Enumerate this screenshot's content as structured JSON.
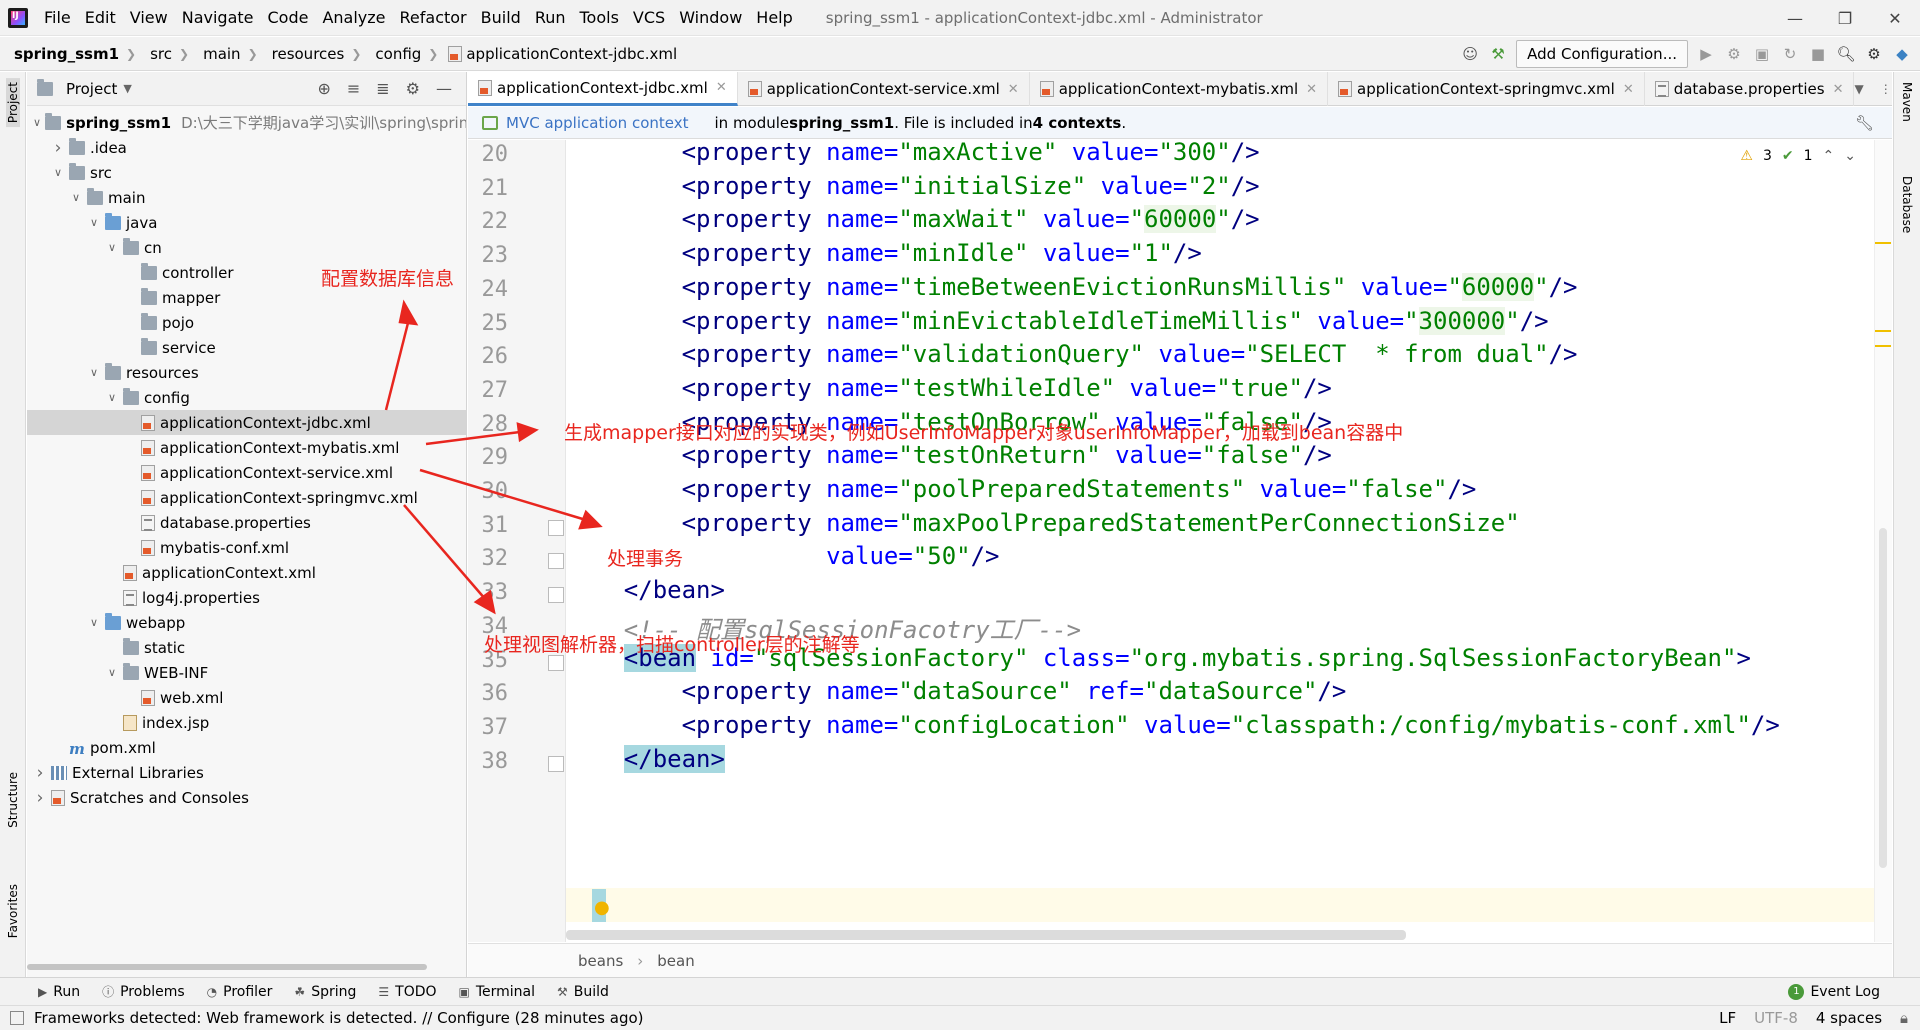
{
  "menubar": {
    "items": [
      "File",
      "Edit",
      "View",
      "Navigate",
      "Code",
      "Analyze",
      "Refactor",
      "Build",
      "Run",
      "Tools",
      "VCS",
      "Window",
      "Help"
    ],
    "title": "spring_ssm1 - applicationContext-jdbc.xml - Administrator"
  },
  "navbar": {
    "crumbs": [
      "spring_ssm1",
      "src",
      "main",
      "resources",
      "config",
      "applicationContext-jdbc.xml"
    ],
    "add_config": "Add Configuration..."
  },
  "left_strip": {
    "project": "Project",
    "structure": "Structure",
    "favorites": "Favorites"
  },
  "right_strip": {
    "maven": "Maven",
    "database": "Database"
  },
  "project_panel": {
    "title": "Project",
    "root_path": "D:\\大三下学期java学习\\实训\\spring\\spring",
    "tree": [
      {
        "label": "spring_ssm1",
        "depth": 0,
        "arrow": "down",
        "icon": "folder"
      },
      {
        "label": ".idea",
        "depth": 1,
        "arrow": "right",
        "icon": "folder"
      },
      {
        "label": "src",
        "depth": 1,
        "arrow": "down",
        "icon": "folder"
      },
      {
        "label": "main",
        "depth": 2,
        "arrow": "down",
        "icon": "folder"
      },
      {
        "label": "java",
        "depth": 3,
        "arrow": "down",
        "icon": "folder-blue"
      },
      {
        "label": "cn",
        "depth": 4,
        "arrow": "down",
        "icon": "folder"
      },
      {
        "label": "controller",
        "depth": 5,
        "arrow": "",
        "icon": "folder"
      },
      {
        "label": "mapper",
        "depth": 5,
        "arrow": "",
        "icon": "folder"
      },
      {
        "label": "pojo",
        "depth": 5,
        "arrow": "",
        "icon": "folder"
      },
      {
        "label": "service",
        "depth": 5,
        "arrow": "",
        "icon": "folder"
      },
      {
        "label": "resources",
        "depth": 3,
        "arrow": "down",
        "icon": "folder"
      },
      {
        "label": "config",
        "depth": 4,
        "arrow": "down",
        "icon": "folder"
      },
      {
        "label": "applicationContext-jdbc.xml",
        "depth": 5,
        "arrow": "",
        "icon": "xml",
        "selected": true
      },
      {
        "label": "applicationContext-mybatis.xml",
        "depth": 5,
        "arrow": "",
        "icon": "xml"
      },
      {
        "label": "applicationContext-service.xml",
        "depth": 5,
        "arrow": "",
        "icon": "xml"
      },
      {
        "label": "applicationContext-springmvc.xml",
        "depth": 5,
        "arrow": "",
        "icon": "xml"
      },
      {
        "label": "database.properties",
        "depth": 5,
        "arrow": "",
        "icon": "prop"
      },
      {
        "label": "mybatis-conf.xml",
        "depth": 5,
        "arrow": "",
        "icon": "xml"
      },
      {
        "label": "applicationContext.xml",
        "depth": 4,
        "arrow": "",
        "icon": "xml"
      },
      {
        "label": "log4j.properties",
        "depth": 4,
        "arrow": "",
        "icon": "prop"
      },
      {
        "label": "webapp",
        "depth": 3,
        "arrow": "down",
        "icon": "folder-blue"
      },
      {
        "label": "static",
        "depth": 4,
        "arrow": "",
        "icon": "folder"
      },
      {
        "label": "WEB-INF",
        "depth": 4,
        "arrow": "down",
        "icon": "folder"
      },
      {
        "label": "web.xml",
        "depth": 5,
        "arrow": "",
        "icon": "xml"
      },
      {
        "label": "index.jsp",
        "depth": 4,
        "arrow": "",
        "icon": "jsp"
      },
      {
        "label": "pom.xml",
        "depth": 1,
        "arrow": "",
        "icon": "m"
      },
      {
        "label": "External Libraries",
        "depth": 0,
        "arrow": "right",
        "icon": "lib"
      },
      {
        "label": "Scratches and Consoles",
        "depth": 0,
        "arrow": "right",
        "icon": "scratch"
      }
    ]
  },
  "tabs": [
    {
      "label": "applicationContext-jdbc.xml",
      "active": true
    },
    {
      "label": "applicationContext-service.xml"
    },
    {
      "label": "applicationContext-mybatis.xml"
    },
    {
      "label": "applicationContext-springmvc.xml"
    },
    {
      "label": "database.properties"
    }
  ],
  "infobar": {
    "link": "MVC application context",
    "text1": "in module ",
    "module": "spring_ssm1",
    "text2": ". File is included in ",
    "contexts": "4 contexts",
    "text3": "."
  },
  "inspections": {
    "warnings": "3",
    "checks": "1"
  },
  "editor_lines": [
    {
      "n": "20",
      "indent": "        ",
      "name": "maxActive",
      "value": "300"
    },
    {
      "n": "21",
      "indent": "        ",
      "name": "initialSize",
      "value": "2"
    },
    {
      "n": "22",
      "indent": "        ",
      "name": "maxWait",
      "value": "60000"
    },
    {
      "n": "23",
      "indent": "        ",
      "name": "minIdle",
      "value": "1"
    },
    {
      "n": "24",
      "indent": "        ",
      "name": "timeBetweenEvictionRunsMillis",
      "value": "60000"
    },
    {
      "n": "25",
      "indent": "        ",
      "name": "minEvictableIdleTimeMillis",
      "value": "300000"
    },
    {
      "n": "26",
      "indent": "        ",
      "name": "validationQuery",
      "value": "SELECT  * from dual"
    },
    {
      "n": "27",
      "indent": "        ",
      "name": "testWhileIdle",
      "value": "true"
    },
    {
      "n": "28",
      "indent": "        ",
      "name": "testOnBorrow",
      "value": "false"
    },
    {
      "n": "29",
      "indent": "        ",
      "name": "testOnReturn",
      "value": "false"
    },
    {
      "n": "30",
      "indent": "        ",
      "name": "poolPreparedStatements",
      "value": "false"
    },
    {
      "n": "31",
      "indent": "        ",
      "name": "maxPoolPreparedStatementPerConnectionSize"
    },
    {
      "n": "32",
      "indent": "                  ",
      "valueonly": "50"
    },
    {
      "n": "33",
      "indent": "    ",
      "raw": "</bean>"
    },
    {
      "n": "34",
      "indent": "    ",
      "comment": "<!-- 配置sqlSessionFacotry工厂-->"
    },
    {
      "n": "35",
      "indent": "    ",
      "bean_id": "sqlSessionFactory",
      "bean_class": "org.mybatis.spring.SqlSessionFactoryBean"
    },
    {
      "n": "36",
      "indent": "        ",
      "name": "dataSource",
      "ref": "dataSource"
    },
    {
      "n": "37",
      "indent": "        ",
      "name": "configLocation",
      "value": "classpath:/config/mybatis-conf.xml"
    },
    {
      "n": "38",
      "indent": "    ",
      "raw": "</bean>"
    }
  ],
  "code_tokens": {
    "property_open": "<property",
    "name_attr": "name=",
    "value_attr": "value=",
    "ref_attr": "ref=",
    "self_close": "/>",
    "bean_open": "<bean",
    "id_attr": "id=",
    "class_attr": "class=",
    "tag_close": ">"
  },
  "editor_breadcrumbs": [
    "beans",
    "bean"
  ],
  "bottom_tools": [
    "Run",
    "Problems",
    "Profiler",
    "Spring",
    "TODO",
    "Terminal",
    "Build"
  ],
  "event_log": "Event Log",
  "status": {
    "message": "Frameworks detected: Web framework is detected. // Configure (28 minutes ago)",
    "line_sep": "LF",
    "encoding": "UTF-8",
    "indent": "4 spaces"
  },
  "annotations": {
    "db": "配置数据库信息",
    "mapper": "生成mapper接口对应的实现类，例如UserInfoMapper对象userInfoMapper，加载到bean容器中",
    "tx": "处理事务",
    "mvc": "处理视图解析器，扫描controller层的注解等"
  },
  "colors": {
    "annotation": "#e8261f",
    "tag": "#000080",
    "attr": "#0000ff",
    "value": "#008000",
    "accent": "#4083c9"
  }
}
